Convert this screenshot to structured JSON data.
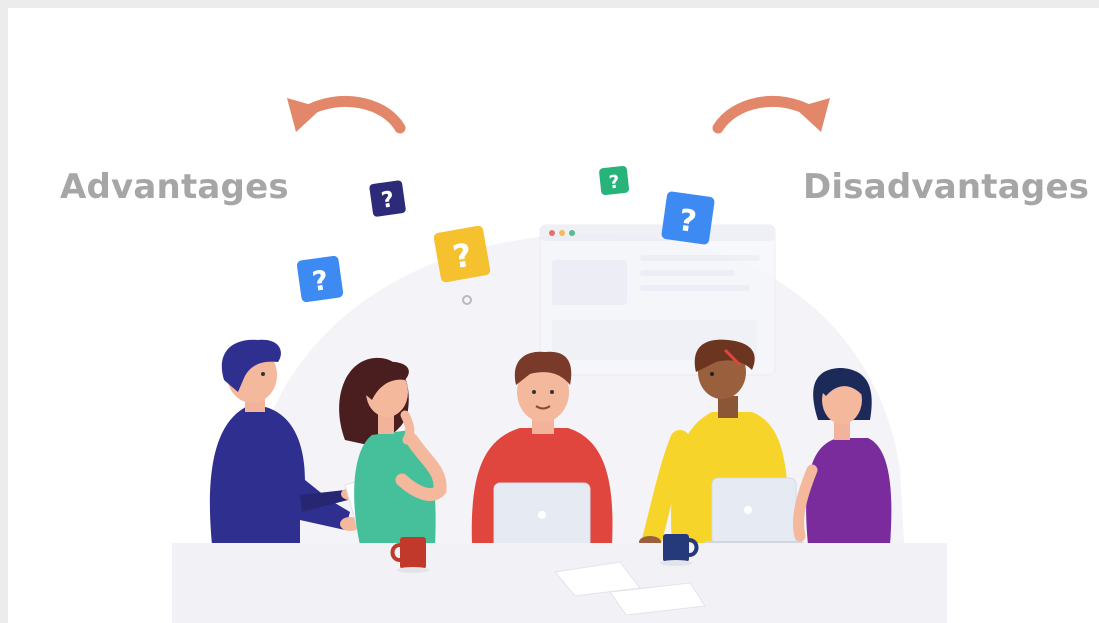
{
  "labels": {
    "left": "Advantages",
    "right": "Disadvantages"
  },
  "question_glyph": "?",
  "colors": {
    "label_gray": "#a6a6a6",
    "arrow": "#e3876b",
    "question_blue": "#3d8bf2",
    "question_navy": "#2d2a7a",
    "question_yellow": "#f6c12e",
    "question_green": "#27b37a",
    "shirt_navy": "#2f2f8f",
    "shirt_teal": "#45c09a",
    "shirt_red": "#e0453e",
    "shirt_yellow": "#f7d42a",
    "shirt_purple": "#7a2c9c"
  },
  "icons": {
    "left_arrow": "curved-arrow-left-icon",
    "right_arrow": "curved-arrow-right-icon",
    "question": "question-mark-icon"
  }
}
